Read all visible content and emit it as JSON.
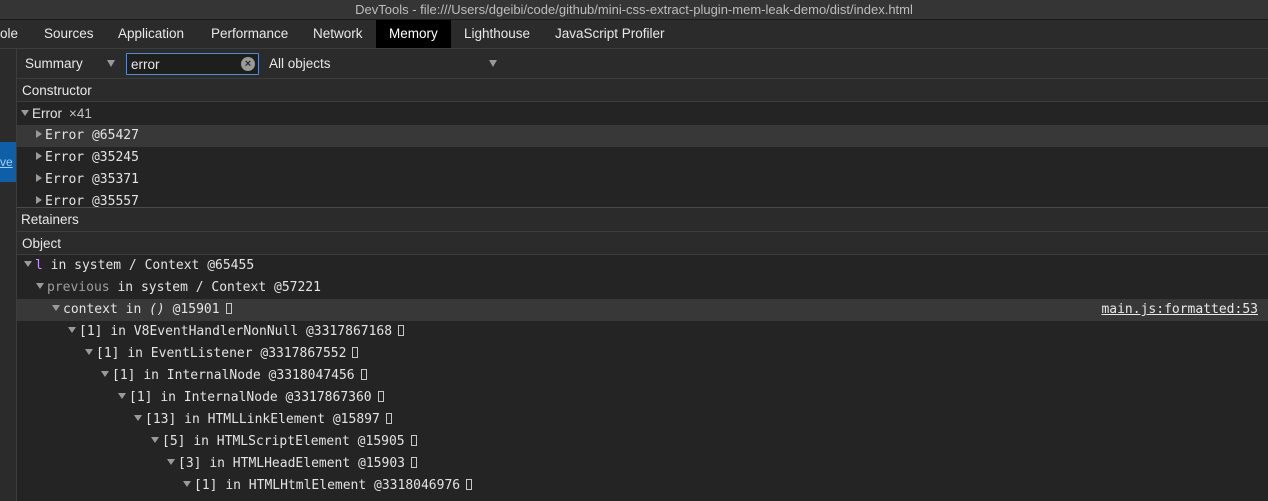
{
  "window": {
    "title": "DevTools - file:///Users/dgeibi/code/github/mini-css-extract-plugin-mem-leak-demo/dist/index.html"
  },
  "tabs": [
    {
      "label": "ole"
    },
    {
      "label": "Sources"
    },
    {
      "label": "Application"
    },
    {
      "label": "Performance"
    },
    {
      "label": "Network"
    },
    {
      "label": "Memory"
    },
    {
      "label": "Lighthouse"
    },
    {
      "label": "JavaScript Profiler"
    }
  ],
  "active_tab": "Memory",
  "left_panel": {
    "button_label": "ve"
  },
  "toolbar": {
    "view_select": "Summary",
    "filter_value": "error",
    "filter_clear_icon": "clear-circle-icon",
    "objects_select": "All objects"
  },
  "constructor_panel": {
    "header": "Constructor",
    "group": {
      "name": "Error",
      "count": "×41"
    },
    "items": [
      {
        "label": "Error @65427"
      },
      {
        "label": "Error @35245"
      },
      {
        "label": "Error @35371"
      },
      {
        "label": "Error @35557"
      }
    ]
  },
  "retainers_panel": {
    "title": "Retainers",
    "header": "Object",
    "rows": [
      {
        "prop": "l",
        "in": "in",
        "obj": "system / Context @65455"
      },
      {
        "prop": "previous",
        "in": "in",
        "obj": "system / Context @57221"
      },
      {
        "prop": "context",
        "in": "in",
        "obj_italic": "()",
        "obj": "@15901",
        "source": "main.js:formatted:53"
      },
      {
        "prop": "[1]",
        "in": "in",
        "obj": "V8EventHandlerNonNull @3317867168"
      },
      {
        "prop": "[1]",
        "in": "in",
        "obj": "EventListener @3317867552"
      },
      {
        "prop": "[1]",
        "in": "in",
        "obj": "InternalNode @3318047456"
      },
      {
        "prop": "[1]",
        "in": "in",
        "obj": "InternalNode @3317867360"
      },
      {
        "prop": "[13]",
        "in": "in",
        "obj": "HTMLLinkElement @15897"
      },
      {
        "prop": "[5]",
        "in": "in",
        "obj": "HTMLScriptElement @15905"
      },
      {
        "prop": "[3]",
        "in": "in",
        "obj": "HTMLHeadElement @15903"
      },
      {
        "prop": "[1]",
        "in": "in",
        "obj": "HTMLHtmlElement @3318046976"
      }
    ]
  },
  "colors": {
    "active_tab_bg": "#000000",
    "accent_button": "#0f5fa8",
    "property": "#c797f5",
    "background": "#242424"
  }
}
